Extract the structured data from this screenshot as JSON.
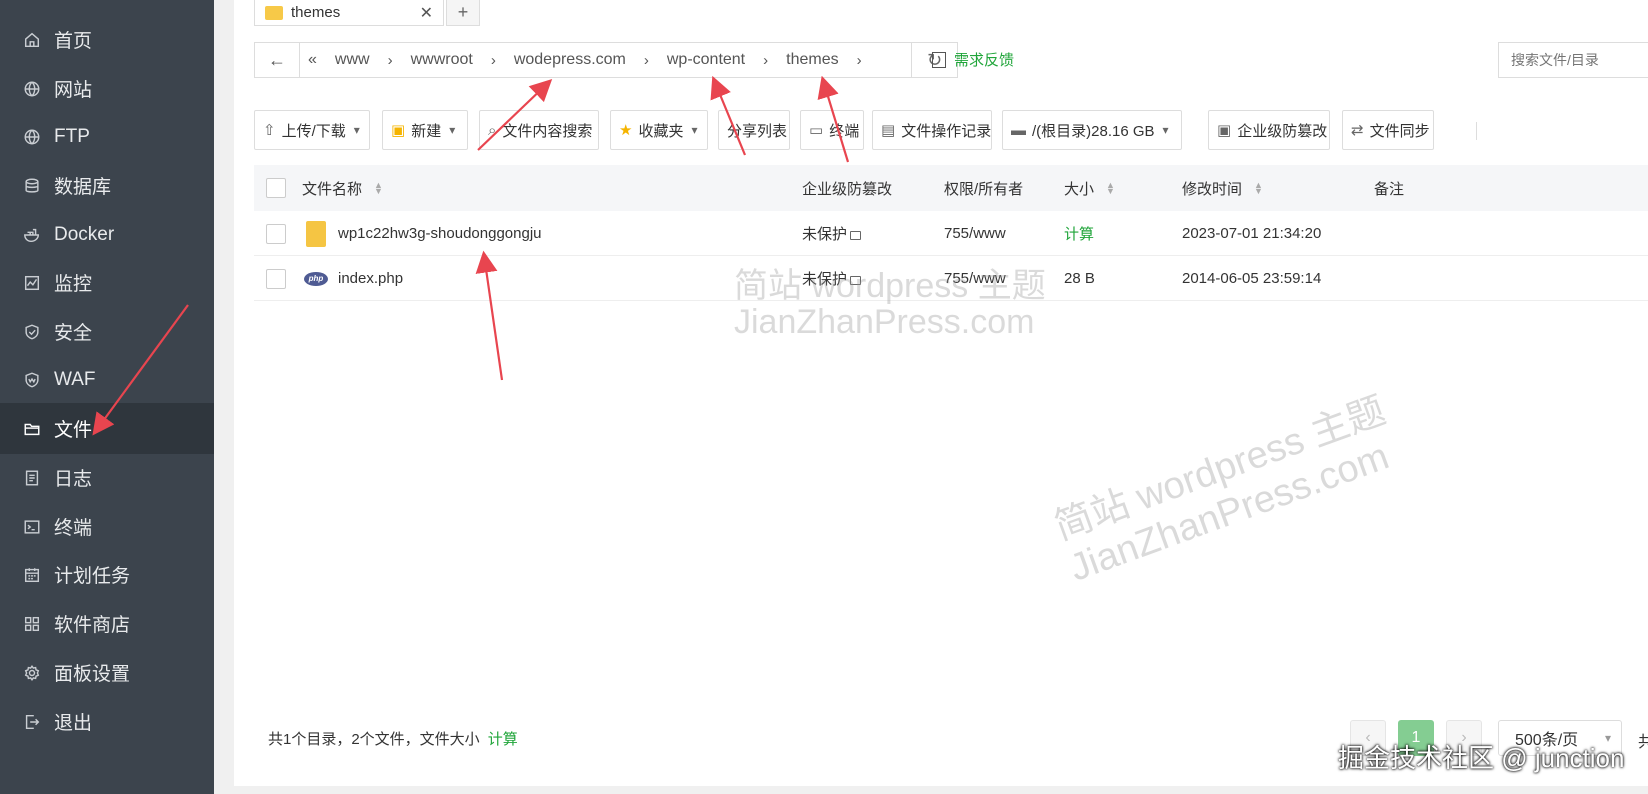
{
  "sidebar": {
    "items": [
      {
        "label": "首页",
        "icon": "home-icon"
      },
      {
        "label": "网站",
        "icon": "globe-icon"
      },
      {
        "label": "FTP",
        "icon": "globe-icon"
      },
      {
        "label": "数据库",
        "icon": "database-icon"
      },
      {
        "label": "Docker",
        "icon": "docker-icon"
      },
      {
        "label": "监控",
        "icon": "monitor-icon"
      },
      {
        "label": "安全",
        "icon": "shield-icon"
      },
      {
        "label": "WAF",
        "icon": "waf-shield-icon"
      },
      {
        "label": "文件",
        "icon": "folder-icon",
        "active": true
      },
      {
        "label": "日志",
        "icon": "log-icon"
      },
      {
        "label": "终端",
        "icon": "terminal-icon"
      },
      {
        "label": "计划任务",
        "icon": "calendar-icon"
      },
      {
        "label": "软件商店",
        "icon": "grid-icon"
      },
      {
        "label": "面板设置",
        "icon": "gear-icon"
      },
      {
        "label": "退出",
        "icon": "logout-icon"
      }
    ]
  },
  "tabs": {
    "current": "themes",
    "close": "✕",
    "add": "+"
  },
  "path": {
    "back": "←",
    "collapse": "«",
    "crumbs": [
      "www",
      "wwwroot",
      "wodepress.com",
      "wp-content",
      "themes"
    ],
    "separator": "›",
    "refresh": "↻"
  },
  "feedback": "需求反馈",
  "search": {
    "placeholder": "搜索文件/目录"
  },
  "toolbar": {
    "upload": "上传/下载",
    "new": "新建",
    "content_search": "文件内容搜索",
    "favorites": "收藏夹",
    "share_list": "分享列表",
    "terminal": "终端",
    "op_log": "文件操作记录",
    "disk": "/(根目录)28.16 GB",
    "tamper": "企业级防篡改",
    "sync": "文件同步"
  },
  "table": {
    "headers": {
      "name": "文件名称",
      "protect": "企业级防篡改",
      "perm": "权限/所有者",
      "size": "大小",
      "mtime": "修改时间",
      "note": "备注"
    },
    "rows": [
      {
        "name": "wp1c22hw3g-shoudonggongju",
        "type": "folder",
        "protect": "未保护",
        "perm": "755/www",
        "size": "计算",
        "mtime": "2023-07-01 21:34:20",
        "note": ""
      },
      {
        "name": "index.php",
        "type": "php",
        "icon_text": "php",
        "protect": "未保护",
        "perm": "755/www",
        "size": "28 B",
        "mtime": "2014-06-05 23:59:14",
        "note": ""
      }
    ]
  },
  "footer": {
    "summary": "共1个目录，2个文件，文件大小",
    "calc": "计算",
    "prev": "‹",
    "page": "1",
    "next": "›",
    "page_size": "500条/页",
    "total_clip": "共"
  },
  "watermark": {
    "line1": "简站 wordpress 主题",
    "line2": "JianZhanPress.com"
  },
  "credit": "掘金技术社区 @ junction",
  "colors": {
    "sidebar_bg": "#3c444d",
    "sidebar_active": "#2f363d",
    "accent_green": "#20a53a",
    "arrow_red": "#e8454f"
  }
}
